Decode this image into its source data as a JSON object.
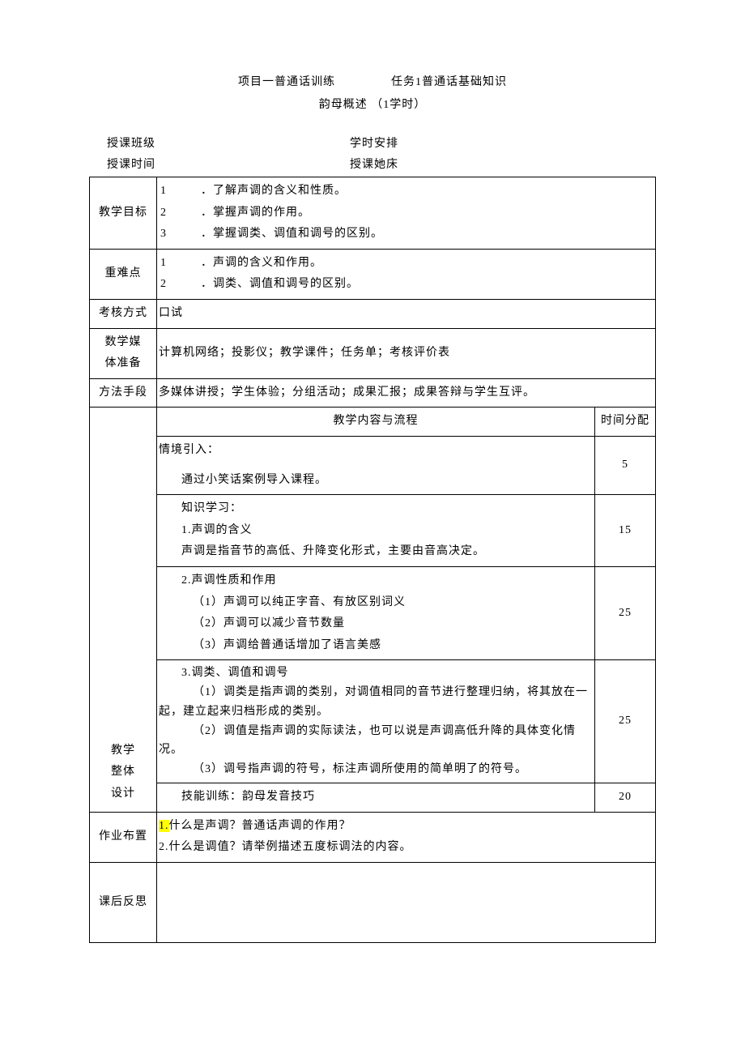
{
  "header": {
    "project": "项目一普通话训练",
    "task": "任务1普通话基础知识",
    "subtitle": "韵母概述 （1学时）"
  },
  "meta": {
    "class_label": "授课班级",
    "hours_label": "学时安排",
    "time_label": "授课时间",
    "place_label": "授课她床"
  },
  "rows": {
    "goal_label": "教学目标",
    "goal_1_n": "1",
    "goal_1_t": "．了解声调的含义和性质。",
    "goal_2_n": "2",
    "goal_2_t": "．掌握声调的作用。",
    "goal_3_n": "3",
    "goal_3_t": "．掌握调类、调值和调号的区别。",
    "diff_label": "重难点",
    "diff_1_n": "1",
    "diff_1_t": "．声调的含义和作用。",
    "diff_2_n": "2",
    "diff_2_t": "．调类、调值和调号的区别。",
    "assess_label": "考核方式",
    "assess_value": "口试",
    "media_label_1": "数学媒",
    "media_label_2": "体准备",
    "media_value": "计算机网络；投影仪；教学课件；任务单；考核评价表",
    "method_label": "方法手段",
    "method_value": "多媒体讲授；学生体验；分组活动；成果汇报；成果答辩与学生互评。"
  },
  "design": {
    "label_1": "教学",
    "label_2": "整体",
    "label_3": "设计",
    "content_header": "教学内容与流程",
    "time_header": "时间分配",
    "seg1_l1": "情境引入：",
    "seg1_l2": "通过小笑话案例导入课程。",
    "seg1_time": "5",
    "seg2_l1": "知识学习：",
    "seg2_l2": "1.声调的含义",
    "seg2_l3": "声调是指音节的高低、升降变化形式，主要由音高决定。",
    "seg2_time": "15",
    "seg3_l1": "2.声调性质和作用",
    "seg3_l2": "（1）声调可以纯正字音、有放区别词义",
    "seg3_l3": "（2）声调可以减少音节数量",
    "seg3_l4": "（3）声调给普通话增加了语言美感",
    "seg3_time": "25",
    "seg4_l1": "3.调类、调值和调号",
    "seg4_l2": "（1）调类是指声调的类别，对调值相同的音节进行整理归纳，将其放在一起，建立起来归档形成的类别。",
    "seg4_l3": "（2）调值是指声调的实际读法，也可以说是声调高低升降的具体变化情况。",
    "seg4_l4": "（3）调号指声调的符号，标注声调所使用的简单明了的符号。",
    "seg4_time": "25",
    "seg5_l1": "技能训练：韵母发音技巧",
    "seg5_time": "20"
  },
  "homework": {
    "label": "作业布置",
    "hl": "1.",
    "l1": "什么是声调？普通话声调的作用？",
    "l2": "2.什么是调值？请举例描述五度标调法的内容。"
  },
  "reflect": {
    "label": "课后反思"
  }
}
